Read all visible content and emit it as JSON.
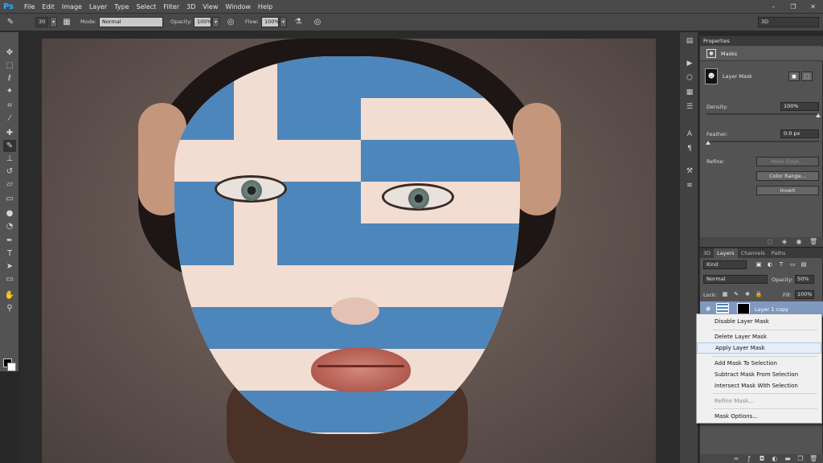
{
  "app": {
    "logo": "Ps"
  },
  "menu": [
    "File",
    "Edit",
    "Image",
    "Layer",
    "Type",
    "Select",
    "Filter",
    "3D",
    "View",
    "Window",
    "Help"
  ],
  "window_controls": {
    "minimize": "–",
    "restore": "❐",
    "close": "✕"
  },
  "options": {
    "brush_size": "30",
    "mode_label": "Mode:",
    "mode_value": "Normal",
    "opacity_label": "Opacity:",
    "opacity_value": "100%",
    "flow_label": "Flow:",
    "flow_value": "100%",
    "workspace": "3D"
  },
  "properties": {
    "tab": "Properties",
    "section": "Masks",
    "mask_title": "Layer Mask",
    "density_label": "Density:",
    "density_value": "100%",
    "feather_label": "Feather:",
    "feather_value": "0.0 px",
    "refine_label": "Refine:",
    "mask_edge_btn": "Mask Edge...",
    "color_range_btn": "Color Range...",
    "invert_btn": "Invert"
  },
  "layers": {
    "tabs": [
      "3D",
      "Layers",
      "Channels",
      "Paths"
    ],
    "active_tab": "Layers",
    "kind": "Kind",
    "blend_mode": "Normal",
    "opacity_label": "Opacity:",
    "opacity_value": "50%",
    "lock_label": "Lock:",
    "fill_label": "Fill:",
    "fill_value": "100%",
    "layer_name": "Layer 1 copy"
  },
  "context_menu": {
    "items": [
      {
        "label": "Disable Layer Mask",
        "disabled": false
      },
      {
        "label": "Delete Layer Mask",
        "disabled": false
      },
      {
        "label": "Apply Layer Mask",
        "disabled": false,
        "hover": true
      },
      {
        "label": "Add Mask To Selection",
        "disabled": false
      },
      {
        "label": "Subtract Mask From Selection",
        "disabled": false
      },
      {
        "label": "Intersect Mask With Selection",
        "disabled": false
      },
      {
        "label": "Refine Mask...",
        "disabled": true
      },
      {
        "label": "Mask Options...",
        "disabled": false
      }
    ]
  },
  "icons": {
    "tools": [
      "move-icon",
      "marquee-icon",
      "lasso-icon",
      "quick-select-icon",
      "crop-icon",
      "eyedropper-icon",
      "healing-icon",
      "brush-icon",
      "stamp-icon",
      "history-brush-icon",
      "eraser-icon",
      "gradient-icon",
      "blur-icon",
      "dodge-icon",
      "pen-icon",
      "type-icon",
      "path-select-icon",
      "shape-icon",
      "hand-icon",
      "zoom-icon"
    ]
  },
  "colors": {
    "accent": "#31a8ff",
    "flag_blue": "#4d86ba",
    "selected_layer": "#7f99bf"
  }
}
